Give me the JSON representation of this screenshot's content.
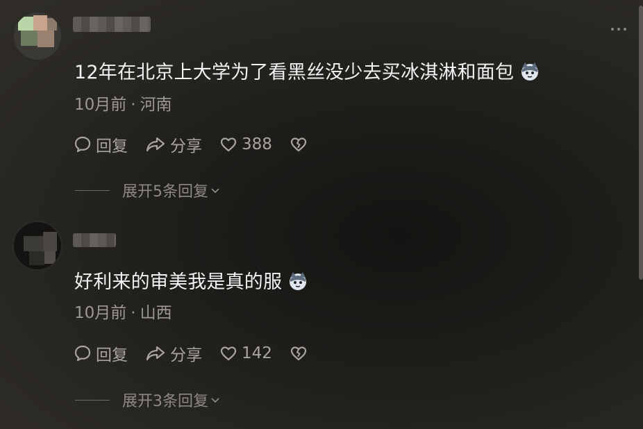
{
  "comments": [
    {
      "text": "12年在北京上大学为了看黑丝没少去买冰淇淋和面包",
      "time": "10月前",
      "location": "河南",
      "reply_label": "回复",
      "share_label": "分享",
      "likes": "388",
      "expand_label": "展开5条回复"
    },
    {
      "text": "好利来的审美我是真的服",
      "time": "10月前",
      "location": "山西",
      "reply_label": "回复",
      "share_label": "分享",
      "likes": "142",
      "expand_label": "展开3条回复"
    }
  ],
  "separator": "·",
  "icons": {
    "reply": "chat-bubble-icon",
    "share": "share-arrow-icon",
    "like": "heart-icon",
    "dislike": "broken-heart-icon",
    "emoji": "cat-face-emoji-icon",
    "more": "more-dots-icon",
    "expand": "chevron-down-icon"
  },
  "colors": {
    "text": "#f2f2f2",
    "meta": "#9c9994",
    "action": "#a8a5a0"
  }
}
